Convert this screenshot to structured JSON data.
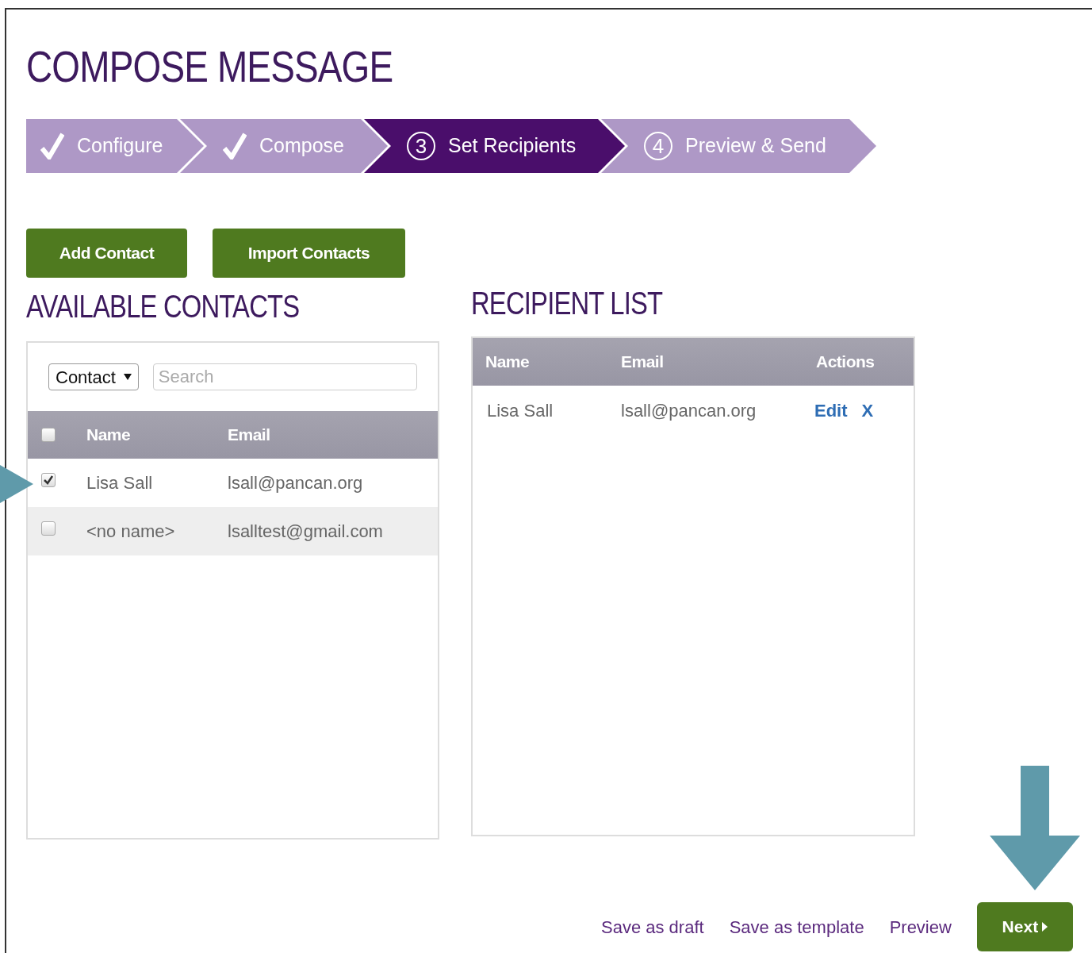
{
  "title": "COMPOSE MESSAGE",
  "steps": [
    {
      "label": "Configure",
      "completed": true,
      "selected": false
    },
    {
      "label": "Compose",
      "completed": true,
      "selected": false
    },
    {
      "label": "Set Recipients",
      "completed": false,
      "selected": true,
      "number": "3"
    },
    {
      "label": "Preview & Send",
      "completed": false,
      "selected": false,
      "number": "4"
    }
  ],
  "actions": [
    "Add Contact",
    "Import Contacts"
  ],
  "available_contacts": {
    "heading": "AVAILABLE CONTACTS",
    "filter": {
      "value": "Contact"
    },
    "search": {
      "placeholder": "Search"
    },
    "select_all": {
      "checked": false
    },
    "columns": [
      "Name",
      "Email"
    ],
    "rows": [
      {
        "checked": true,
        "name": "Lisa Sall",
        "email": "lsall@pancan.org"
      },
      {
        "checked": false,
        "name": "<no name>",
        "email": "lsalltest@gmail.com"
      }
    ]
  },
  "recipient_list": {
    "heading": "RECIPIENT LIST",
    "columns": [
      "Name",
      "Email",
      "Actions"
    ],
    "rows": [
      {
        "name": "Lisa Sall",
        "email": "lsall@pancan.org",
        "edit": "Edit",
        "remove": "X"
      }
    ]
  },
  "footer": {
    "links": [
      "Save as draft",
      "Save as template",
      "Preview"
    ],
    "next": "Next"
  }
}
